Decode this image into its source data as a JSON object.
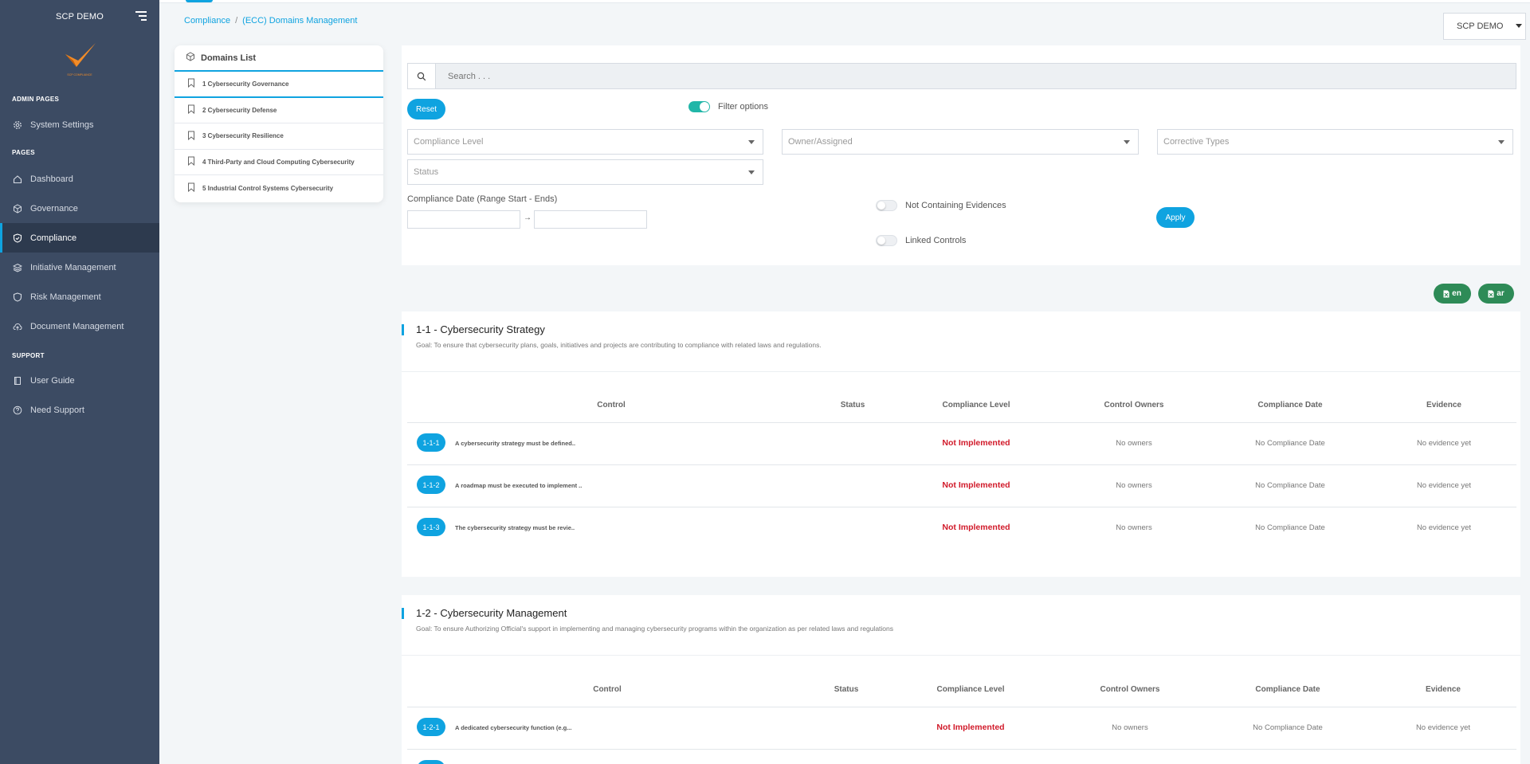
{
  "app": {
    "name": "SCP DEMO",
    "logo_caption": "SCP COMPLIANCE"
  },
  "sidebar": {
    "admin_section": "ADMIN PAGES",
    "admin_items": [
      {
        "label": "System Settings",
        "icon": "gear-icon"
      }
    ],
    "pages_section": "PAGES",
    "page_items": [
      {
        "label": "Dashboard",
        "icon": "home-icon"
      },
      {
        "label": "Governance",
        "icon": "cube-icon"
      },
      {
        "label": "Compliance",
        "icon": "shield-check-icon",
        "active": true
      },
      {
        "label": "Initiative Management",
        "icon": "layers-icon"
      },
      {
        "label": "Risk Management",
        "icon": "shield-icon"
      },
      {
        "label": "Document Management",
        "icon": "cloud-upload-icon"
      }
    ],
    "support_section": "SUPPORT",
    "support_items": [
      {
        "label": "User Guide",
        "icon": "book-icon"
      },
      {
        "label": "Need Support",
        "icon": "help-circle-icon"
      }
    ]
  },
  "breadcrumb": {
    "root": "Compliance",
    "separator": "/",
    "current": "(ECC) Domains Management"
  },
  "org_select": {
    "value": "SCP DEMO"
  },
  "domains": {
    "title": "Domains List",
    "items": [
      "1 Cybersecurity Governance",
      "2 Cybersecurity Defense",
      "3 Cybersecurity Resilience",
      "4 Third-Party and Cloud Computing Cybersecurity",
      "5 Industrial Control Systems Cybersecurity"
    ]
  },
  "filters": {
    "search_placeholder": "Search . . .",
    "reset_label": "Reset",
    "filter_options_label": "Filter options",
    "compliance_level_placeholder": "Compliance Level",
    "owner_placeholder": "Owner/Assigned",
    "corrective_placeholder": "Corrective Types",
    "status_placeholder": "Status",
    "date_range_label": "Compliance Date (Range Start - Ends)",
    "range_arrow": "→",
    "not_containing_label": "Not Containing Evidences",
    "linked_controls_label": "Linked Controls",
    "apply_label": "Apply"
  },
  "export": {
    "en_label": "en",
    "ar_label": "ar"
  },
  "table_headers": [
    "Control",
    "Status",
    "Compliance Level",
    "Control Owners",
    "Compliance Date",
    "Evidence"
  ],
  "sections": [
    {
      "title": "1-1 - Cybersecurity Strategy",
      "goal": "Goal: To ensure that cybersecurity plans, goals, initiatives and projects are contributing to compliance with related laws and regulations.",
      "rows": [
        {
          "id": "1-1-1",
          "text": "A cybersecurity strategy must be defined..",
          "status": "",
          "level": "Not Implemented",
          "owners": "No owners",
          "date": "No Compliance Date",
          "evidence": "No evidence yet"
        },
        {
          "id": "1-1-2",
          "text": "A roadmap must be executed to implement ..",
          "status": "",
          "level": "Not Implemented",
          "owners": "No owners",
          "date": "No Compliance Date",
          "evidence": "No evidence yet"
        },
        {
          "id": "1-1-3",
          "text": "The cybersecurity strategy must be revie..",
          "status": "",
          "level": "Not Implemented",
          "owners": "No owners",
          "date": "No Compliance Date",
          "evidence": "No evidence yet"
        }
      ]
    },
    {
      "title": "1-2 - Cybersecurity Management",
      "goal": "Goal: To ensure Authorizing Official's support in implementing and managing cybersecurity programs within the organization as per related laws and regulations",
      "rows": [
        {
          "id": "1-2-1",
          "text": "A dedicated cybersecurity function (e.g...",
          "status": "",
          "level": "Not Implemented",
          "owners": "No owners",
          "date": "No Compliance Date",
          "evidence": "No evidence yet"
        }
      ]
    }
  ],
  "colors": {
    "sidebar": "#3c4b63",
    "accent": "#0fa3e0",
    "danger": "#d11a2a",
    "export": "#2e8b57"
  }
}
